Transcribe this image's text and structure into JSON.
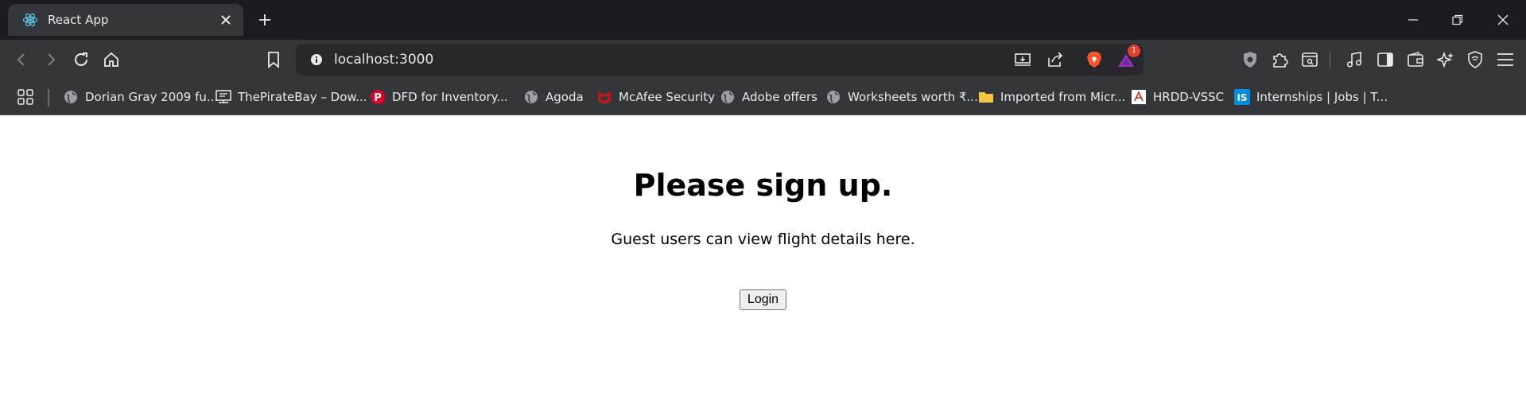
{
  "tab": {
    "title": "React App"
  },
  "address_bar": {
    "url": "localhost:3000",
    "notification_count": "1"
  },
  "bookmarks": [
    {
      "label": "Dorian Gray 2009 fu...",
      "icon": "globe-icon"
    },
    {
      "label": "ThePirateBay – Dow...",
      "icon": "site-icon"
    },
    {
      "label": "DFD for Inventory...",
      "icon": "pinterest-icon"
    },
    {
      "label": "Agoda",
      "icon": "globe-icon"
    },
    {
      "label": "McAfee Security",
      "icon": "mcafee-icon"
    },
    {
      "label": "Adobe offers",
      "icon": "globe-icon"
    },
    {
      "label": "Worksheets worth ₹...",
      "icon": "globe-icon"
    },
    {
      "label": "Imported from Micr...",
      "icon": "folder-icon"
    },
    {
      "label": "HRDD-VSSC",
      "icon": "site-icon"
    },
    {
      "label": "Internships | Jobs | T...",
      "icon": "internshala-icon"
    }
  ],
  "page": {
    "heading": "Please sign up.",
    "subtitle": "Guest users can view flight details here.",
    "login_label": "Login"
  },
  "colors": {
    "chrome_dark": "#1c1b22",
    "toolbar": "#35363a",
    "brave_orange": "#fb542b",
    "mcafee_red": "#c01818",
    "pinterest_red": "#e60023",
    "internshala_blue": "#008bdc"
  }
}
